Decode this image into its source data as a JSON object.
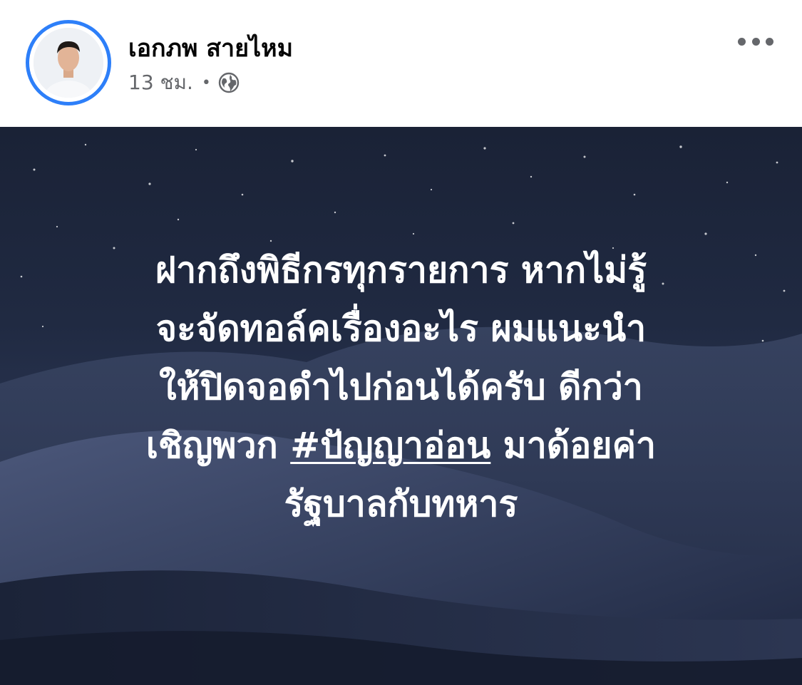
{
  "post": {
    "author": {
      "name": "เอกภพ สายไหม",
      "avatar_icon": "profile-photo"
    },
    "meta": {
      "time": "13 ชม.",
      "separator": "•",
      "audience_icon": "globe-icon"
    },
    "more_icon": "more-options-icon",
    "body": {
      "line1": "ฝากถึงพิธีกรทุกรายการ หากไม่รู้",
      "line2": "จะจัดทอล์คเรื่องอะไร ผมแนะนำ",
      "line3": "ให้ปิดจอดำไปก่อนได้ครับ ดีกว่า",
      "line4_prefix": "เชิญพวก ",
      "line4_hashtag": "#ปัญญาอ่อน",
      "line4_suffix": " มาด้อยค่า",
      "line5": "รัฐบาลกับทหาร"
    },
    "colors": {
      "avatar_ring": "#2d7ff9",
      "background_top": "#1a2236",
      "background_bottom": "#1d2740",
      "text": "#ffffff",
      "meta_text": "#65676b"
    }
  }
}
